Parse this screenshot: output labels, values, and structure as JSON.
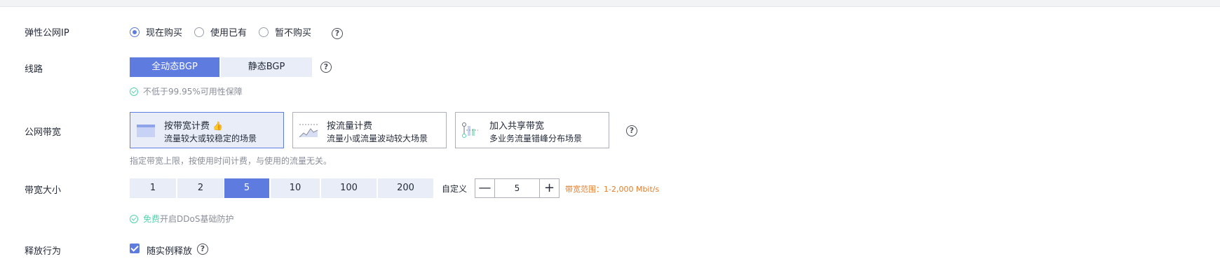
{
  "eip": {
    "label": "弹性公网IP",
    "options": [
      "现在购买",
      "使用已有",
      "暂不购买"
    ],
    "selected": 0,
    "help": "?"
  },
  "line": {
    "label": "线路",
    "options": [
      "全动态BGP",
      "静态BGP"
    ],
    "selected": 0,
    "help": "?",
    "note": "不低于99.95%可用性保障"
  },
  "bandwidth_billing": {
    "label": "公网带宽",
    "cards": [
      {
        "title": "按带宽计费",
        "desc": "流量较大或较稳定的场景",
        "icon": "bandwidth-icon",
        "recommended_icon": "thumbs-up-icon"
      },
      {
        "title": "按流量计费",
        "desc": "流量小或流量波动较大场景",
        "icon": "traffic-icon"
      },
      {
        "title": "加入共享带宽",
        "desc": "多业务流量错峰分布场景",
        "icon": "shared-bandwidth-icon"
      }
    ],
    "selected": 0,
    "help": "?",
    "note": "指定带宽上限，按使用时间计费，与使用的流量无关。"
  },
  "bandwidth_size": {
    "label": "带宽大小",
    "options": [
      "1",
      "2",
      "5",
      "10",
      "100",
      "200"
    ],
    "selected": 2,
    "custom_label": "自定义",
    "value": "5",
    "minus": "—",
    "plus": "+",
    "range_text": "带宽范围：1-2,000 Mbit/s",
    "ddos_free": "免费",
    "ddos_note": "开启DDoS基础防护"
  },
  "release": {
    "label": "释放行为",
    "checkbox_label": "随实例释放",
    "checked": true,
    "help": "?"
  },
  "colors": {
    "accent": "#5e7ce0",
    "accent_light": "#e8edf8",
    "success": "#50d4ab",
    "warning": "#e37d29"
  }
}
